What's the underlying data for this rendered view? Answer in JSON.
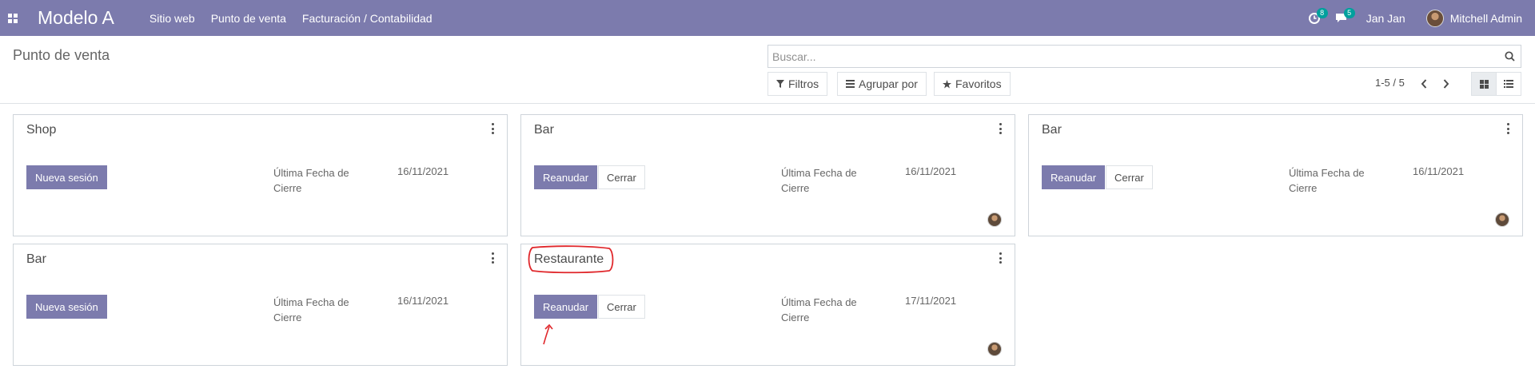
{
  "navbar": {
    "brand": "Modelo A",
    "menu": [
      "Sitio web",
      "Punto de venta",
      "Facturación / Contabilidad"
    ],
    "activity_badge": "8",
    "messages_badge": "5",
    "company": "Jan Jan",
    "user": "Mitchell Admin",
    "color": "#7c7bad"
  },
  "control_panel": {
    "title": "Punto de venta",
    "search_placeholder": "Buscar...",
    "filters": "Filtros",
    "group_by": "Agrupar por",
    "favorites": "Favoritos",
    "pager": "1-5 / 5"
  },
  "cards": [
    {
      "title": "Shop",
      "primary": "Nueva sesión",
      "secondary": "",
      "closing_label": "Última Fecha de Cierre",
      "date": "16/11/2021",
      "avatar": false
    },
    {
      "title": "Bar",
      "primary": "Reanudar",
      "secondary": "Cerrar",
      "closing_label": "Última Fecha de Cierre",
      "date": "16/11/2021",
      "avatar": true
    },
    {
      "title": "Bar",
      "primary": "Reanudar",
      "secondary": "Cerrar",
      "closing_label": "Última Fecha de Cierre",
      "date": "16/11/2021",
      "avatar": true
    },
    {
      "title": "Bar",
      "primary": "Nueva sesión",
      "secondary": "",
      "closing_label": "Última Fecha de Cierre",
      "date": "16/11/2021",
      "avatar": false
    },
    {
      "title": "Restaurante",
      "primary": "Reanudar",
      "secondary": "Cerrar",
      "closing_label": "Última Fecha de Cierre",
      "date": "17/11/2021",
      "avatar": true
    }
  ],
  "annotation_color": "#e0272b"
}
